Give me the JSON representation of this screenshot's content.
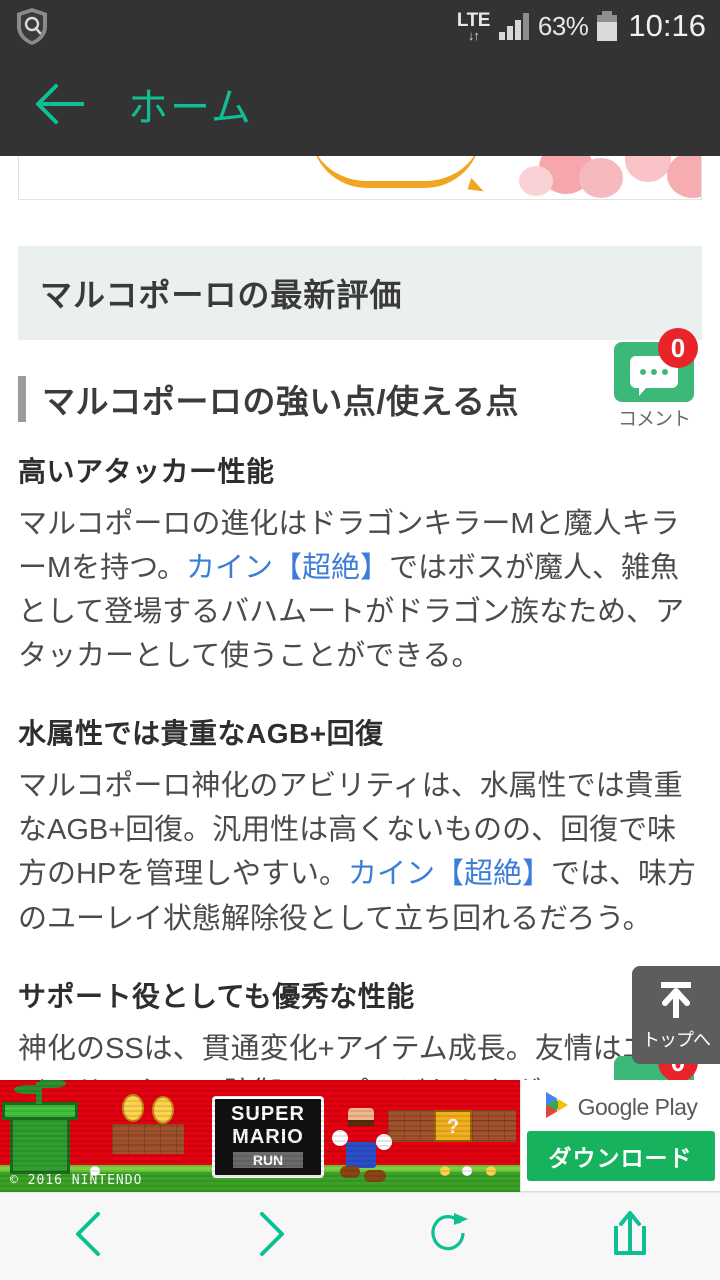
{
  "status_bar": {
    "app_icon": "shield-search-icon",
    "network_type": "LTE",
    "data_arrows": "↓↑",
    "signal_icon": "signal-bars-icon",
    "battery_percent": "63%",
    "battery_icon": "battery-icon",
    "clock": "10:16"
  },
  "navbar": {
    "back_icon": "back-arrow-icon",
    "title": "ホーム"
  },
  "top_banner": {
    "alt": "amazon-sakura-banner"
  },
  "section_band": {
    "title": "マルコポーロの最新評価"
  },
  "heading": {
    "text": "マルコポーロの強い点/使える点"
  },
  "comment_widget": {
    "icon": "comment-bubble-icon",
    "badge": "0",
    "label": "コメント"
  },
  "comment_widget_2": {
    "icon": "comment-bubble-icon",
    "badge": "0"
  },
  "article": {
    "blocks": [
      {
        "sub_head": "高いアタッカー性能",
        "text_before": "マルコポーロの進化はドラゴンキラーMと魔人キラーMを持つ。",
        "link": "カイン【超絶】",
        "text_after": "ではボスが魔人、雑魚として登場するバハムートがドラゴン族なため、アタッカーとして使うことができる。"
      },
      {
        "sub_head": "水属性では貴重なAGB+回復",
        "text_before": "マルコポーロ神化のアビリティは、水属性では貴重なAGB+回復。汎用性は高くないものの、回復で味方のHPを管理しやすい。",
        "link": "カイン【超絶】",
        "text_after": "では、味方のユーレイ状態解除役として立ち回れるだろう。"
      },
      {
        "sub_head": "サポート役としても優秀な性能",
        "text_before": "神化のSSは、貫通変化+アイテム成長。友情はエナジーサークルL+防御アップ。どちらもダメージ源として使える上、味方のサポートとしても使い勝手が良い。",
        "link": "",
        "text_after": ""
      }
    ]
  },
  "to_top": {
    "icon": "arrow-up-icon",
    "label": "トップへ"
  },
  "ad": {
    "logo_line1": "SUPER",
    "logo_line2": "MARIO",
    "logo_line3": "RUN",
    "qbox": "?",
    "copyright": "© 2016 NINTENDO",
    "store_name": "Google Play",
    "store_icon": "google-play-icon",
    "download_label": "ダウンロード"
  },
  "bottom_nav": {
    "items": [
      {
        "name": "back",
        "icon": "chevron-left-icon"
      },
      {
        "name": "forward",
        "icon": "chevron-right-icon"
      },
      {
        "name": "reload",
        "icon": "reload-icon"
      },
      {
        "name": "share",
        "icon": "share-icon"
      }
    ]
  },
  "colors": {
    "accent_teal": "#0fbf93",
    "link_blue": "#3b7dd8",
    "comment_green": "#3cb878",
    "badge_red": "#e8232a",
    "navbar_dark": "#333333",
    "band_gray": "#eaeff0",
    "download_green": "#16b25d"
  }
}
